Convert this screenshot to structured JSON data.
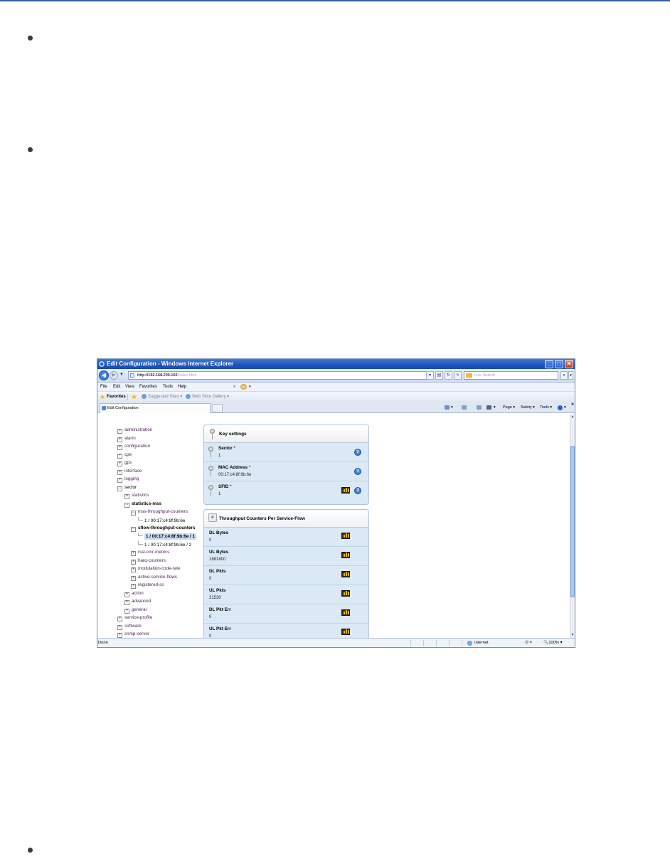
{
  "browser": {
    "title": "Edit Configuration - Windows Internet Explorer",
    "address": {
      "host": "http://192.168.200.102",
      "path": "/index.html"
    },
    "search_placeholder": "Live Search",
    "menu": [
      "File",
      "Edit",
      "View",
      "Favorites",
      "Tools",
      "Help"
    ],
    "menu_close": "x",
    "favorites_label": "Favorites",
    "favorite_links": [
      "Suggested Sites ▾",
      "Web Slice Gallery ▾"
    ],
    "tab_title": "Edit Configuration",
    "command_bar": [
      "Page ▾",
      "Safety ▾",
      "Tools ▾"
    ],
    "status": {
      "text": "Done",
      "zone": "Internet",
      "protected": "▾",
      "zoom": "100%"
    }
  },
  "tree": [
    {
      "label": "administration",
      "type": "collapsed"
    },
    {
      "label": "alarm",
      "type": "collapsed"
    },
    {
      "label": "configuration",
      "type": "collapsed"
    },
    {
      "label": "cpe",
      "type": "collapsed"
    },
    {
      "label": "gps",
      "type": "collapsed"
    },
    {
      "label": "interface",
      "type": "collapsed"
    },
    {
      "label": "logging",
      "type": "collapsed"
    },
    {
      "label": "sector",
      "type": "expanded"
    },
    {
      "label": "statistics",
      "type": "collapsed"
    },
    {
      "label": "statistics-mss",
      "type": "expanded"
    },
    {
      "label": "mss-throughput-counters",
      "type": "expanded"
    },
    {
      "label": "1 / 00:17:c4:8f:9b:6e",
      "type": "leaf"
    },
    {
      "label": "sflow-throughput-counters",
      "type": "expanded"
    },
    {
      "label": "1 / 00:17:c4:8f:9b:6e / 1",
      "type": "leaf-selected"
    },
    {
      "label": "1 / 00:17:c4:8f:9b:6e / 2",
      "type": "leaf"
    },
    {
      "label": "rssi-cinr-metrics",
      "type": "collapsed"
    },
    {
      "label": "harq-counters",
      "type": "collapsed"
    },
    {
      "label": "modulation-code-rate",
      "type": "collapsed"
    },
    {
      "label": "active-service-flows",
      "type": "collapsed"
    },
    {
      "label": "registered-ss",
      "type": "collapsed"
    },
    {
      "label": "action",
      "type": "collapsed"
    },
    {
      "label": "advanced",
      "type": "collapsed"
    },
    {
      "label": "general",
      "type": "collapsed"
    },
    {
      "label": "service-profile",
      "type": "collapsed"
    },
    {
      "label": "software",
      "type": "collapsed"
    },
    {
      "label": "snmp-server",
      "type": "collapsed"
    }
  ],
  "key_settings": {
    "title": "Key settings",
    "fields": [
      {
        "label": "Sector",
        "value": "1",
        "chart": false
      },
      {
        "label": "MAC Address",
        "value": "00:17:c4:8f:9b:6e",
        "chart": false
      },
      {
        "label": "SFID",
        "value": "1",
        "chart": true
      }
    ],
    "required_mark": "*"
  },
  "throughput": {
    "title": "Throughput Counters Per Service-Flow",
    "fields": [
      {
        "label": "DL Bytes",
        "value": "0"
      },
      {
        "label": "UL Bytes",
        "value": "1881800"
      },
      {
        "label": "DL Pkts",
        "value": "0"
      },
      {
        "label": "UL Pkts",
        "value": "31530"
      },
      {
        "label": "DL Pkt Err",
        "value": "0"
      },
      {
        "label": "UL Pkt Err",
        "value": "0"
      }
    ]
  },
  "colors": {
    "titlebar": "#1e54b8",
    "panel": "#dbe9f6",
    "tree_link": "#4d1f57"
  }
}
